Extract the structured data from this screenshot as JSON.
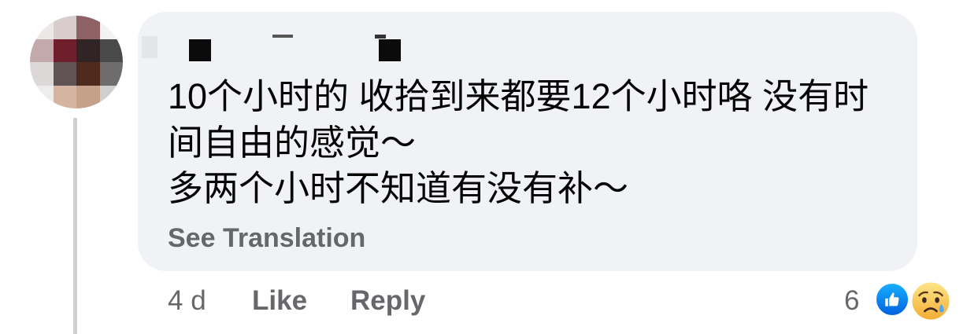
{
  "comment": {
    "text_lines": [
      "10个小时的 收拾到来都要12个小时咯 没有时",
      "间自由的感觉～",
      "多两个小时不知道有没有补～"
    ],
    "see_translation": "See Translation"
  },
  "actions": {
    "timestamp": "4 d",
    "like": "Like",
    "reply": "Reply"
  },
  "reactions": {
    "count": "6",
    "types": [
      "like-icon",
      "sad-icon"
    ]
  },
  "colors": {
    "bubble": "#f0f2f5",
    "text": "#050505",
    "secondary_text": "#65676b",
    "like_blue": "#1877f2",
    "thread_line": "#ced0d4"
  }
}
